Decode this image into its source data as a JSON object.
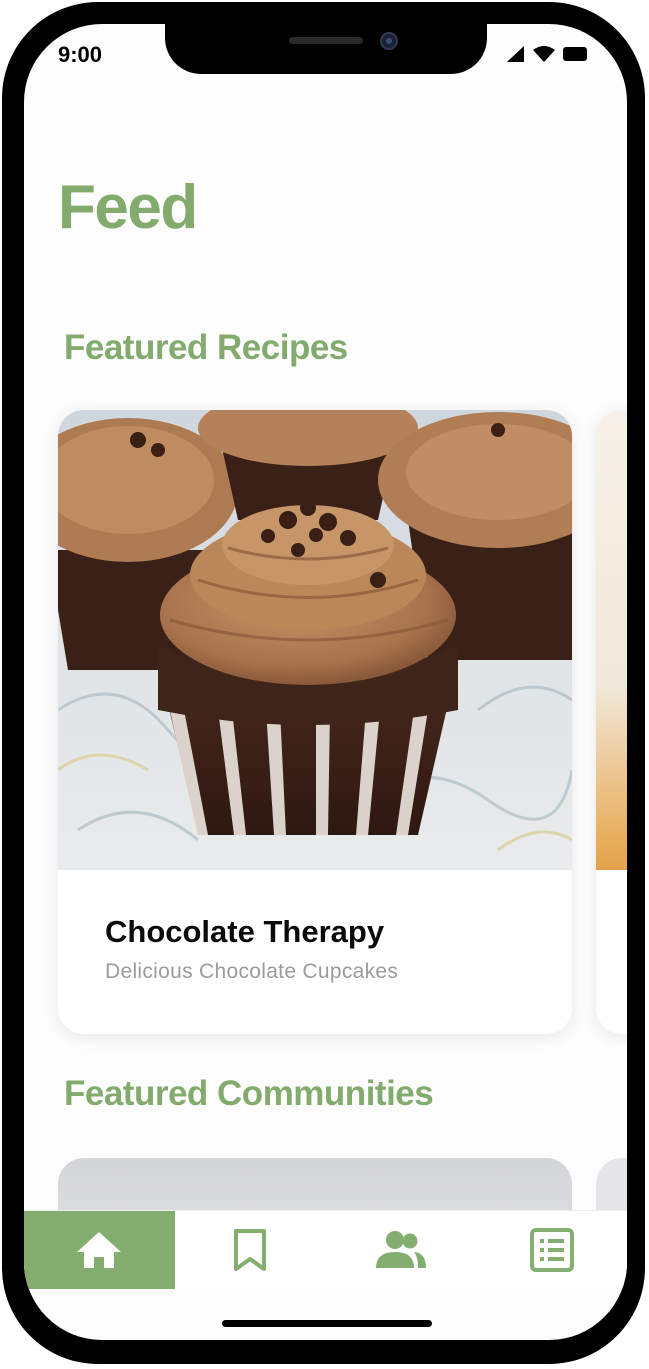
{
  "status_bar": {
    "time": "9:00"
  },
  "header": {
    "title": "Feed"
  },
  "featured_recipes": {
    "heading": "Featured Recipes",
    "cards": [
      {
        "title": "Chocolate Therapy",
        "subtitle": "Delicious Chocolate Cupcakes"
      }
    ]
  },
  "featured_communities": {
    "heading": "Featured Communities"
  },
  "tab_bar": {
    "tabs": [
      {
        "icon": "home-icon",
        "active": true
      },
      {
        "icon": "bookmark-icon",
        "active": false
      },
      {
        "icon": "people-icon",
        "active": false
      },
      {
        "icon": "list-icon",
        "active": false
      }
    ]
  },
  "colors": {
    "accent": "#83ae70",
    "title": "#82ab6d",
    "card_title": "#0b0b0b",
    "card_subtitle": "#9b9b9b"
  }
}
